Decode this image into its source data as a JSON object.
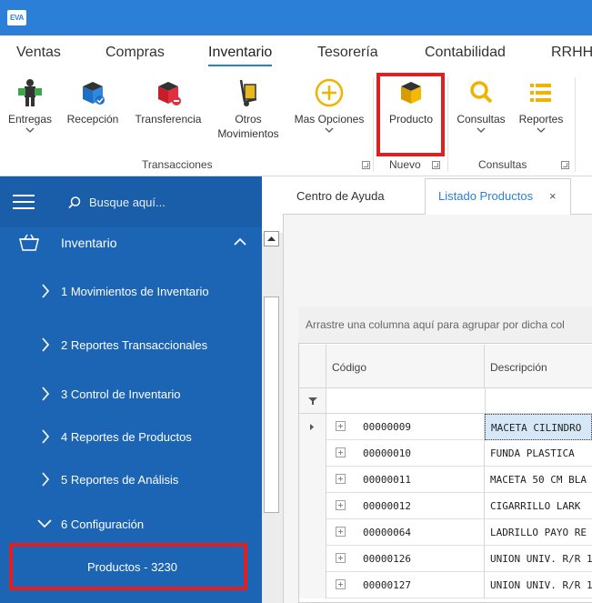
{
  "app": {
    "logo_text": "EVA"
  },
  "menu": {
    "tabs": [
      {
        "label": "Ventas"
      },
      {
        "label": "Compras"
      },
      {
        "label": "Inventario",
        "active": true
      },
      {
        "label": "Tesorería"
      },
      {
        "label": "Contabilidad"
      },
      {
        "label": "RRHH"
      }
    ]
  },
  "ribbon": {
    "buttons": {
      "entregas": "Entregas",
      "recepcion": "Recepción",
      "transferencia": "Transferencia",
      "otros_line1": "Otros",
      "otros_line2": "Movimientos",
      "mas_opciones": "Mas Opciones",
      "producto": "Producto",
      "consultas": "Consultas",
      "reportes": "Reportes"
    },
    "groups": {
      "transacciones": "Transacciones",
      "nuevo": "Nuevo",
      "consultas": "Consultas"
    }
  },
  "sidebar": {
    "search_placeholder": "Busque aquí...",
    "section_title": "Inventario",
    "items": [
      {
        "label": "1 Movimientos de Inventario"
      },
      {
        "label": "2 Reportes Transaccionales"
      },
      {
        "label": "3 Control de Inventario"
      },
      {
        "label": "4 Reportes de Productos"
      },
      {
        "label": "5 Reportes de Análisis"
      },
      {
        "label": "6 Configuración",
        "expanded": true
      }
    ],
    "subitem": "Productos - 3230"
  },
  "main": {
    "tabs": [
      {
        "label": "Centro de Ayuda"
      },
      {
        "label": "Listado Productos",
        "active": true,
        "close": "×"
      }
    ],
    "group_panel_text": "Arrastre una columna aquí para agrupar por dicha col",
    "columns": {
      "code": "Código",
      "description": "Descripción"
    },
    "rows": [
      {
        "code": "00000009",
        "desc": "MACETA CILINDRO"
      },
      {
        "code": "00000010",
        "desc": "FUNDA PLASTICA"
      },
      {
        "code": "00000011",
        "desc": "MACETA 50 CM BLA"
      },
      {
        "code": "00000012",
        "desc": "CIGARRILLO LARK"
      },
      {
        "code": "00000064",
        "desc": "LADRILLO PAYO RE"
      },
      {
        "code": "00000126",
        "desc": "UNION UNIV. R/R 1"
      },
      {
        "code": "00000127",
        "desc": "UNION UNIV. R/R 1"
      }
    ]
  },
  "colors": {
    "accent": "#2c7fd6",
    "sidebar": "#1c64b4",
    "highlight": "#e02020",
    "selected_row": "#d6e8f8"
  }
}
